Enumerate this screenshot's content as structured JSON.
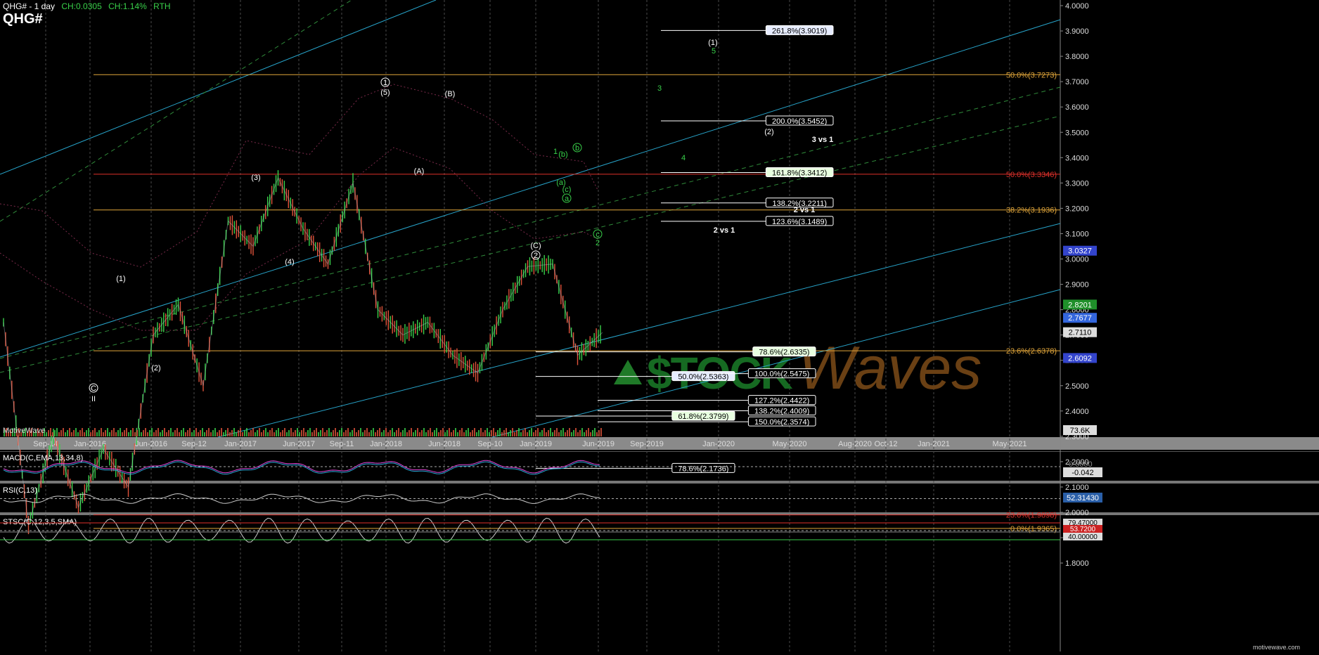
{
  "header": {
    "title": "QHG# - 1 day",
    "change_abs": "CH:0.0305",
    "change_pct": "CH:1.14%",
    "session": "RTH",
    "symbol": "QHG#"
  },
  "branding": {
    "platform": "MotiveWave",
    "watermark": "StockWaves",
    "footer": "motivewave.com"
  },
  "colors": {
    "bg": "#000000",
    "up": "#39d14a",
    "down": "#e0533a",
    "fib_red": "#e0312b",
    "fib_orange": "#e0a53a",
    "trend_cyan": "#27a3c9",
    "trend_green": "#2f8a3a",
    "label_green": "#39d14a"
  },
  "chart_data": [
    {
      "type": "line",
      "title": "QHG# - 1 day",
      "x_tick_labels": [
        "Sep-14",
        "Jan-2016",
        "Jun-2016",
        "Sep-12",
        "Jan-2017",
        "Jun-2017",
        "Sep-11",
        "Jan-2018",
        "Jun-2018",
        "Sep-10",
        "Jan-2019",
        "Jun-2019",
        "Sep-2019",
        "Jan-2020",
        "May-2020",
        "Aug-2020",
        "Oct-12",
        "Jan-2021",
        "May-2021"
      ],
      "y_tick_labels": [
        "1.8000",
        "1.9000",
        "2.0000",
        "2.1000",
        "2.2000",
        "2.3000",
        "2.4000",
        "2.5000",
        "2.6000",
        "2.7000",
        "2.8000",
        "2.9000",
        "3.0000",
        "3.1000",
        "3.2000",
        "3.3000",
        "3.4000",
        "3.5000",
        "3.6000",
        "3.7000",
        "3.8000",
        "3.9000",
        "4.0000"
      ],
      "ylim": [
        1.8,
        4.0
      ],
      "series": [
        {
          "x": [
            "Sep-14",
            "Jan-2016",
            "Apr-2016",
            "Jun-2016",
            "Sep-12",
            "Nov-2016",
            "Jan-2017",
            "Mar-2017",
            "Jun-2017",
            "Sep-11",
            "Nov-2017",
            "Jan-2018",
            "Mar-2018",
            "May-2018",
            "Jun-2018",
            "Jul-2018",
            "Sep-10",
            "Oct-2018",
            "Nov-2018",
            "Jan-2019",
            "Feb-2019",
            "Mar-2019",
            "Apr-2019",
            "Jun-2019",
            "Jun-2019b"
          ],
          "values": [
            2.75,
            1.95,
            2.3,
            2.02,
            2.25,
            2.1,
            2.7,
            2.82,
            2.5,
            3.15,
            3.05,
            3.32,
            3.12,
            2.98,
            3.3,
            2.8,
            2.7,
            2.75,
            2.62,
            2.55,
            2.8,
            2.97,
            2.98,
            2.62,
            2.71
          ]
        }
      ],
      "price_labels": [
        {
          "text": "3.0327",
          "value": 3.0327,
          "color": "#3344cc"
        },
        {
          "text": "2.8201",
          "value": 2.8201,
          "color": "#1f8f2a"
        },
        {
          "text": "2.7677",
          "value": 2.7677,
          "color": "#3366dd"
        },
        {
          "text": "2.7110",
          "value": 2.711,
          "color": "#dddddd"
        },
        {
          "text": "2.6092",
          "value": 2.6092,
          "color": "#3344cc"
        },
        {
          "text": "73.6K",
          "value": 1.78,
          "color": "#dddddd"
        }
      ],
      "fib_levels": [
        {
          "text": "261.8%(3.9019)",
          "value": 3.9019,
          "color": "#ffffff"
        },
        {
          "text": "200.0%(3.5452)",
          "value": 3.5452,
          "color": "#ffffff"
        },
        {
          "text": "161.8%(3.3412)",
          "value": 3.3412,
          "color": "#ffffff"
        },
        {
          "text": "138.2%(3.2211)",
          "value": 3.2211,
          "color": "#ffffff"
        },
        {
          "text": "123.6%(3.1489)",
          "value": 3.1489,
          "color": "#ffffff"
        },
        {
          "text": "78.6%(2.6335)",
          "value": 2.6335,
          "color": "#ffffff"
        },
        {
          "text": "50.0%(2.5363)",
          "value": 2.5363,
          "color": "#ffffff"
        },
        {
          "text": "100.0%(2.5475)",
          "value": 2.5475,
          "color": "#ffffff"
        },
        {
          "text": "127.2%(2.4422)",
          "value": 2.4422,
          "color": "#ffffff"
        },
        {
          "text": "138.2%(2.4009)",
          "value": 2.4009,
          "color": "#ffffff"
        },
        {
          "text": "61.8%(2.3799)",
          "value": 2.3799,
          "color": "#ffffff"
        },
        {
          "text": "150.0%(2.3574)",
          "value": 2.3574,
          "color": "#ffffff"
        },
        {
          "text": "78.6%(2.1736)",
          "value": 2.1736,
          "color": "#ffffff"
        }
      ],
      "right_fibs": [
        {
          "text": "50.0%(3.7273)",
          "value": 3.7273,
          "color": "#e0a53a"
        },
        {
          "text": "50.0%(3.3346)",
          "value": 3.3346,
          "color": "#e0312b"
        },
        {
          "text": "38.2%(3.1936)",
          "value": 3.1936,
          "color": "#e0a53a"
        },
        {
          "text": "23.6%(2.6378)",
          "value": 2.6378,
          "color": "#e0a53a"
        },
        {
          "text": "23.6%(1.9898)",
          "value": 1.9898,
          "color": "#e0312b"
        },
        {
          "text": "0.0%(1.9365)",
          "value": 1.9365,
          "color": "#e0a53a"
        }
      ],
      "wave_labels": [
        {
          "text": "(1)",
          "color": "#ffffff"
        },
        {
          "text": "(2)",
          "color": "#ffffff"
        },
        {
          "text": "(3)",
          "color": "#ffffff"
        },
        {
          "text": "(4)",
          "color": "#ffffff"
        },
        {
          "text": "(5)",
          "color": "#ffffff"
        },
        {
          "text": "(A)",
          "color": "#ffffff"
        },
        {
          "text": "(B)",
          "color": "#ffffff"
        },
        {
          "text": "(C)",
          "color": "#ffffff"
        },
        {
          "text": "C",
          "color": "#ffffff"
        },
        {
          "text": "II",
          "color": "#ffffff"
        },
        {
          "text": "1",
          "color": "#ffffff"
        },
        {
          "text": "2",
          "color": "#ffffff"
        },
        {
          "text": "(1)",
          "color": "#ffffff"
        },
        {
          "text": "(2)",
          "color": "#ffffff"
        },
        {
          "text": "5",
          "color": "#39d14a"
        },
        {
          "text": "3",
          "color": "#39d14a"
        },
        {
          "text": "4",
          "color": "#39d14a"
        },
        {
          "text": "1",
          "color": "#39d14a"
        },
        {
          "text": "(b)",
          "color": "#39d14a"
        },
        {
          "text": "b",
          "color": "#39d14a"
        },
        {
          "text": "(a)",
          "color": "#39d14a"
        },
        {
          "text": "(c)",
          "color": "#39d14a"
        },
        {
          "text": "a",
          "color": "#39d14a"
        },
        {
          "text": "c",
          "color": "#39d14a"
        },
        {
          "text": "2",
          "color": "#39d14a"
        },
        {
          "text": "3 vs 1",
          "color": "#ffffff"
        },
        {
          "text": "2 vs 1",
          "color": "#ffffff"
        },
        {
          "text": "2 vs 1",
          "color": "#ffffff"
        }
      ],
      "grid": true
    },
    {
      "type": "line",
      "title": "MACD(C,EMA,13,34,8)",
      "value_label": "-0.042",
      "zero_label": "0.0000"
    },
    {
      "type": "line",
      "title": "RSI(C,13)",
      "value_label": "52.31430"
    },
    {
      "type": "line",
      "title": "STSC(C,12,3,5,SMA)",
      "value_labels": [
        "79.47000",
        "53.7200",
        "40.00000"
      ]
    }
  ]
}
